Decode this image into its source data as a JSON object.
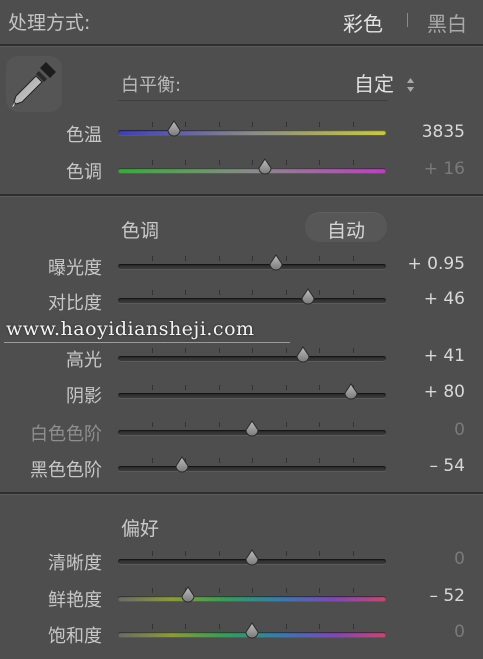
{
  "header": {
    "title": "处理方式:",
    "mode_color": "彩色",
    "mode_bw": "黑白"
  },
  "wb": {
    "label": "白平衡:",
    "value": "自定"
  },
  "basic": {
    "temp": {
      "label": "色温",
      "value": "3835",
      "level": 0.21
    },
    "tint": {
      "label": "色调",
      "value": "+ 16",
      "level": 0.55
    }
  },
  "tone": {
    "title": "色调",
    "auto": "自动",
    "exposure": {
      "label": "曝光度",
      "value": "+ 0.95",
      "level": 0.59
    },
    "contrast": {
      "label": "对比度",
      "value": "+ 46",
      "level": 0.71
    },
    "highlights": {
      "label": "高光",
      "value": "+ 41",
      "level": 0.69
    },
    "shadows": {
      "label": "阴影",
      "value": "+ 80",
      "level": 0.87
    },
    "whites": {
      "label": "白色色阶",
      "value": "0",
      "level": 0.5
    },
    "blacks": {
      "label": "黑色色阶",
      "value": "– 54",
      "level": 0.24
    }
  },
  "watermark": "www.haoyidiansheji.com",
  "presence": {
    "title": "偏好",
    "clarity": {
      "label": "清晰度",
      "value": "0",
      "level": 0.5
    },
    "vibrance": {
      "label": "鲜艳度",
      "value": "– 52",
      "level": 0.26
    },
    "saturation": {
      "label": "饱和度",
      "value": "0",
      "level": 0.5
    }
  },
  "colors": {
    "temp_gradient_start": "#3f3fb0",
    "temp_gradient_end": "#c8c84a",
    "tint_gradient_start": "#3fa640",
    "tint_gradient_end": "#b544b8"
  }
}
